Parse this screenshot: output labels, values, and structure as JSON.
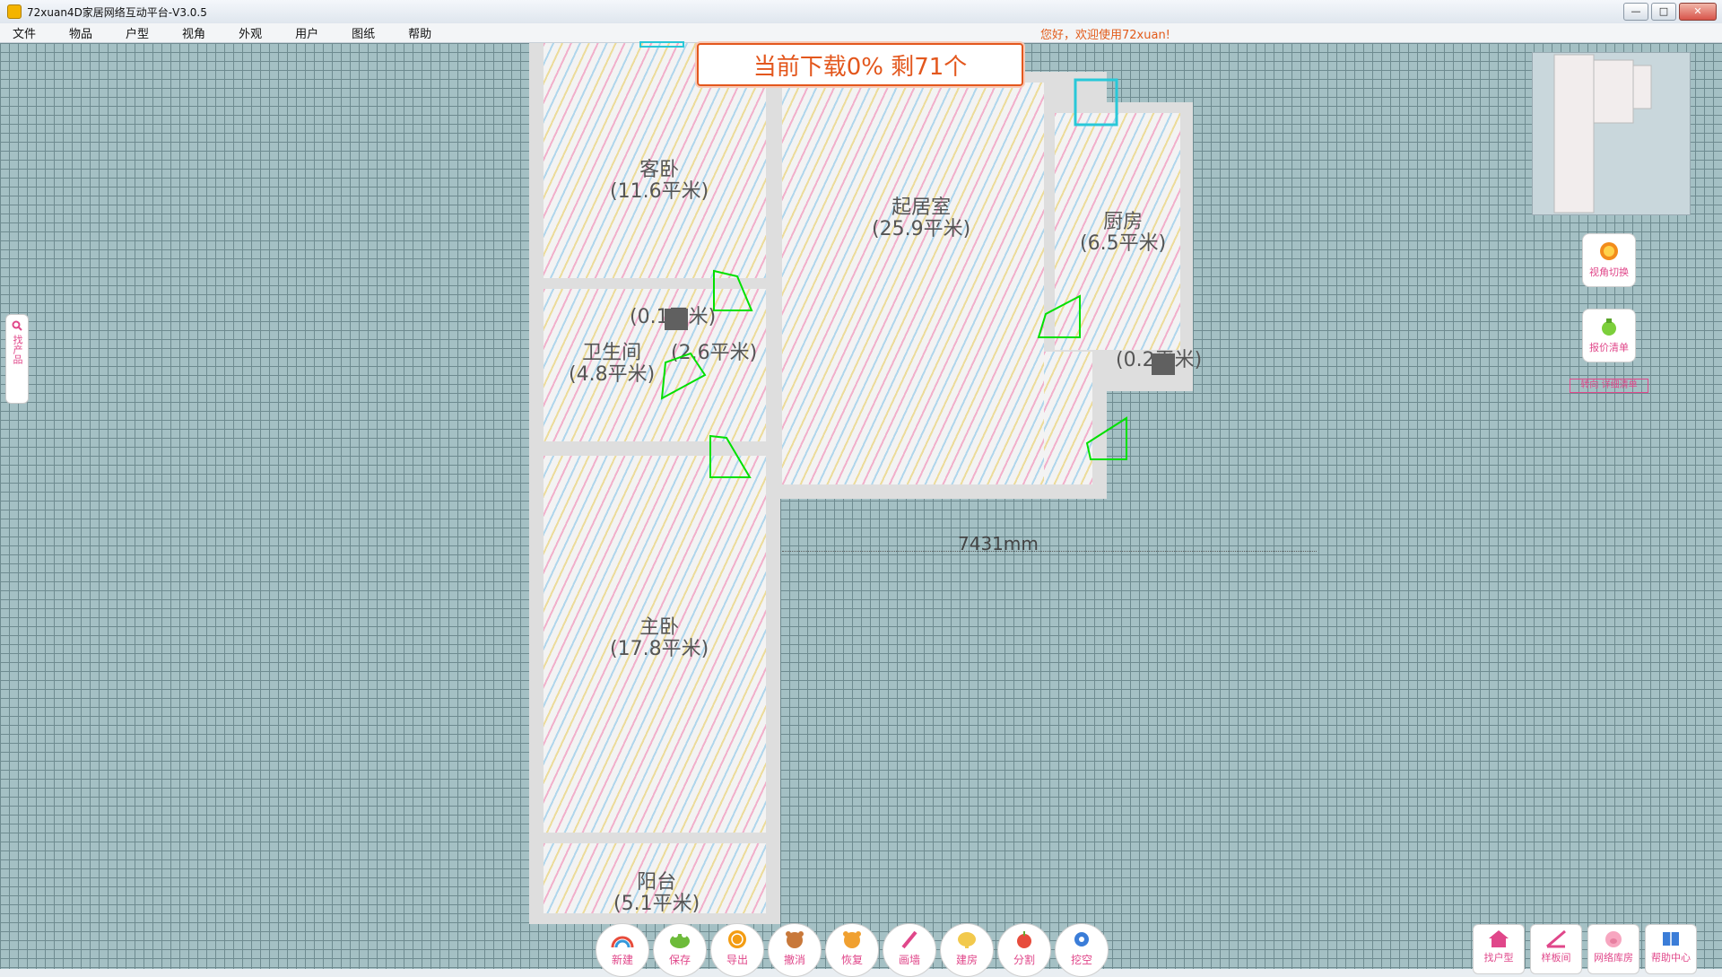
{
  "window": {
    "title": "72xuan4D家居网络互动平台-V3.0.5",
    "controls": [
      "—",
      "□",
      "✕"
    ]
  },
  "menu": {
    "items": [
      "文件",
      "物品",
      "户型",
      "视角",
      "外观",
      "用户",
      "图纸",
      "帮助"
    ],
    "welcome": "您好，欢迎使用72xuan!"
  },
  "banner": {
    "text": "当前下载0% 剩71个"
  },
  "rooms": [
    {
      "name": "客卧",
      "area": "(11.6平米)"
    },
    {
      "name": "起居室",
      "area": "(25.9平米)"
    },
    {
      "name": "厨房",
      "area": "(6.5平米)"
    },
    {
      "name": "卫生间",
      "area": "(4.8平米)"
    },
    {
      "name": "主卧",
      "area": "(17.8平米)"
    },
    {
      "name": "阳台",
      "area": "(5.1平米)"
    }
  ],
  "small_areas": [
    "(0.1平米)",
    "(2.6平米)",
    "(0.2平米)"
  ],
  "dimension": {
    "label": "7431mm"
  },
  "side_tab": {
    "label": "找产品"
  },
  "right_tools": {
    "view_switch": "视角切换",
    "quote_list": "报价清单",
    "small_link": "转向 详细清单"
  },
  "bottom_toolbar": [
    "新建",
    "保存",
    "导出",
    "撤消",
    "恢复",
    "画墙",
    "建房",
    "分割",
    "挖空"
  ],
  "corner_toolbar": [
    "找户型",
    "样板间",
    "网络库房",
    "帮助中心"
  ],
  "colors": {
    "accent": "#e3571d",
    "pink": "#e0478a",
    "grid": "#a4c0c4"
  }
}
